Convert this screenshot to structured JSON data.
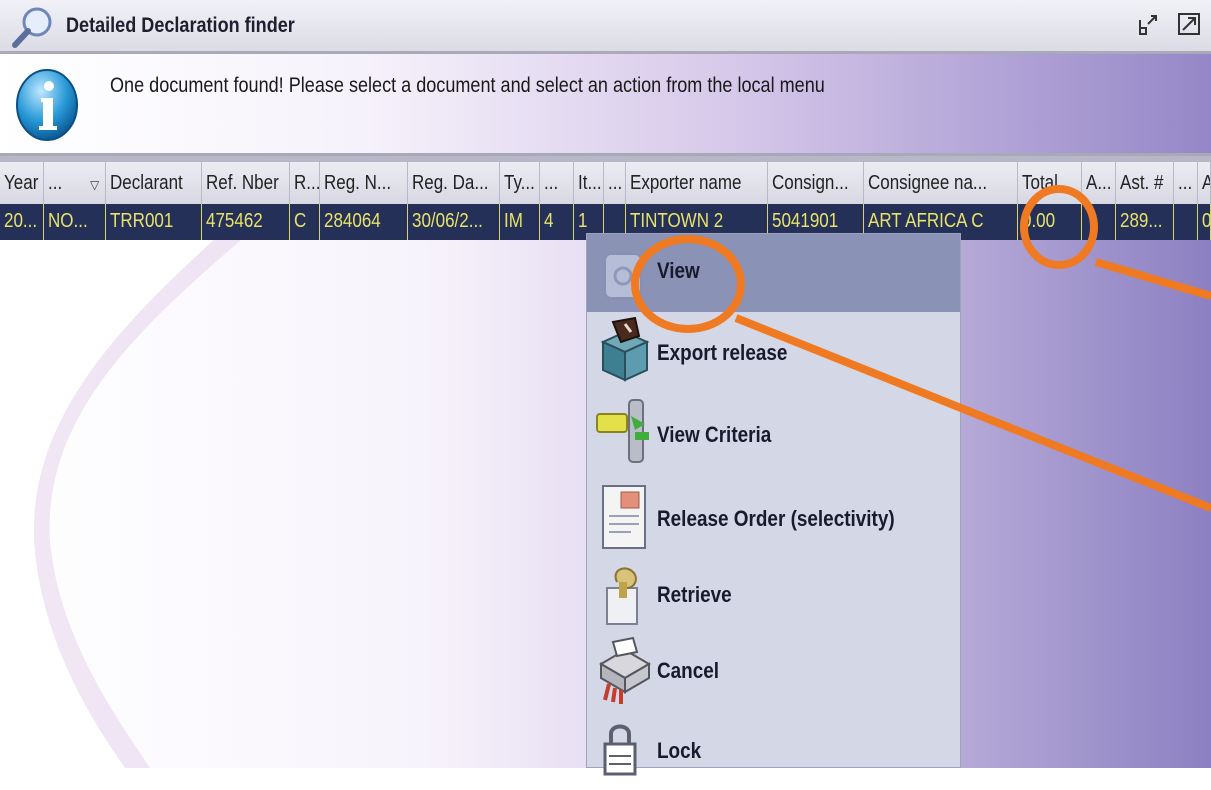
{
  "window": {
    "title": "Detailed Declaration finder"
  },
  "info": {
    "message": "One document found! Please select a document and select an action from the local menu"
  },
  "table": {
    "headers": [
      "Year",
      "...",
      "Declarant",
      "Ref. Nber",
      "R...",
      "Reg. N...",
      "Reg. Da...",
      "Ty...",
      "...",
      "It...",
      "...",
      "Exporter name",
      "Consign...",
      "Consignee na...",
      "Total",
      "A...",
      "Ast. #",
      "...",
      "A"
    ],
    "row": [
      "20...",
      "NO...",
      "TRR001",
      "475462",
      "C",
      "284064",
      "30/06/2...",
      "IM",
      "4",
      "1",
      "",
      "TINTOWN 2",
      "5041901",
      "ART AFRICA C",
      "0.00",
      "",
      "289...",
      "",
      "0"
    ]
  },
  "menu": {
    "items": [
      {
        "label": "View",
        "icon": "view-icon"
      },
      {
        "label": "Export release",
        "icon": "export-release-icon"
      },
      {
        "label": "View Criteria",
        "icon": "view-criteria-icon"
      },
      {
        "label": "Release Order (selectivity)",
        "icon": "release-order-icon"
      },
      {
        "label": "Retrieve",
        "icon": "retrieve-icon"
      },
      {
        "label": "Cancel",
        "icon": "cancel-icon"
      },
      {
        "label": "Lock",
        "icon": "lock-icon"
      }
    ]
  },
  "colors": {
    "highlight": "#f07a22",
    "selected_row": "#243057",
    "selected_text": "#e8e26a",
    "menu_active": "#8a93b6"
  }
}
